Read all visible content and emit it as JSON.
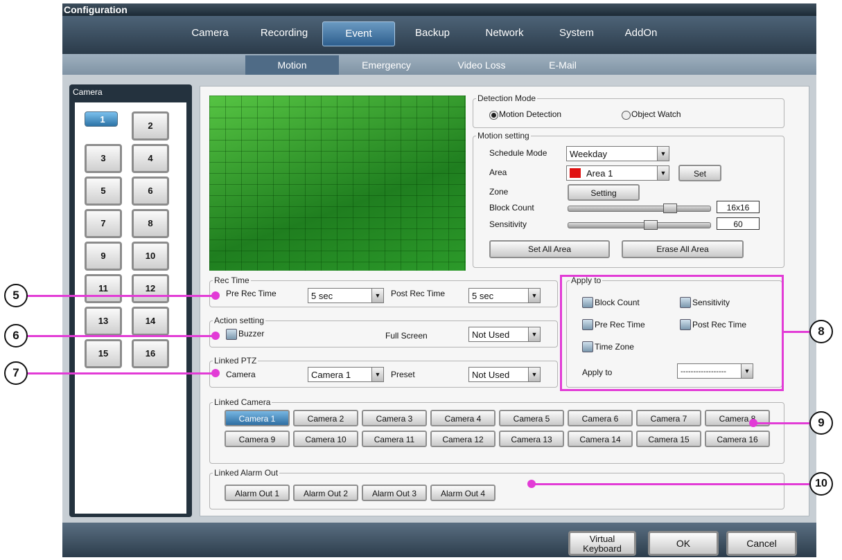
{
  "window": {
    "title": "Configuration"
  },
  "tabs": [
    "Camera",
    "Recording",
    "Event",
    "Backup",
    "Network",
    "System",
    "AddOn"
  ],
  "subtabs": [
    "Motion",
    "Emergency",
    "Video Loss",
    "E-Mail"
  ],
  "camera_panel": {
    "header": "Camera",
    "cameras": [
      "1",
      "2",
      "3",
      "4",
      "5",
      "6",
      "7",
      "8",
      "9",
      "10",
      "11",
      "12",
      "13",
      "14",
      "15",
      "16"
    ]
  },
  "detection": {
    "legend": "Detection Mode",
    "motion": "Motion Detection",
    "object": "Object Watch"
  },
  "motion": {
    "legend": "Motion setting",
    "schedule_label": "Schedule Mode",
    "schedule_value": "Weekday",
    "area_label": "Area",
    "area_value": "Area 1",
    "area_color": "#e01010",
    "set_button": "Set",
    "zone_label": "Zone",
    "zone_button": "Setting",
    "block_label": "Block Count",
    "block_value": "16x16",
    "sens_label": "Sensitivity",
    "sens_value": "60",
    "set_all": "Set All Area",
    "erase_all": "Erase All Area"
  },
  "rec": {
    "legend": "Rec Time",
    "pre_label": "Pre Rec Time",
    "pre_value": "5 sec",
    "post_label": "Post Rec Time",
    "post_value": "5 sec"
  },
  "action": {
    "legend": "Action setting",
    "buzzer": "Buzzer",
    "fullscreen_label": "Full Screen",
    "fullscreen_value": "Not Used"
  },
  "ptz": {
    "legend": "Linked PTZ",
    "camera_label": "Camera",
    "camera_value": "Camera 1",
    "preset_label": "Preset",
    "preset_value": "Not Used"
  },
  "apply": {
    "legend": "Apply to",
    "block": "Block Count",
    "sens": "Sensitivity",
    "pre": "Pre Rec Time",
    "post": "Post Rec Time",
    "zone": "Time Zone",
    "apply_label": "Apply to",
    "apply_value": "------------------"
  },
  "linked_camera": {
    "legend": "Linked Camera",
    "cameras": [
      "Camera 1",
      "Camera 2",
      "Camera 3",
      "Camera 4",
      "Camera 5",
      "Camera 6",
      "Camera 7",
      "Camera 8",
      "Camera 9",
      "Camera 10",
      "Camera 11",
      "Camera 12",
      "Camera 13",
      "Camera 14",
      "Camera 15",
      "Camera 16"
    ]
  },
  "linked_alarm": {
    "legend": "Linked Alarm Out",
    "alarms": [
      "Alarm Out 1",
      "Alarm Out 2",
      "Alarm Out 3",
      "Alarm Out 4"
    ]
  },
  "bottom": {
    "virtual_line1": "Virtual",
    "virtual_line2": "Keyboard",
    "ok": "OK",
    "cancel": "Cancel"
  },
  "callouts": [
    "5",
    "6",
    "7",
    "8",
    "9",
    "10"
  ],
  "colors": {
    "callout_line": "#e23bd6",
    "accent": "#2e6ea2"
  }
}
